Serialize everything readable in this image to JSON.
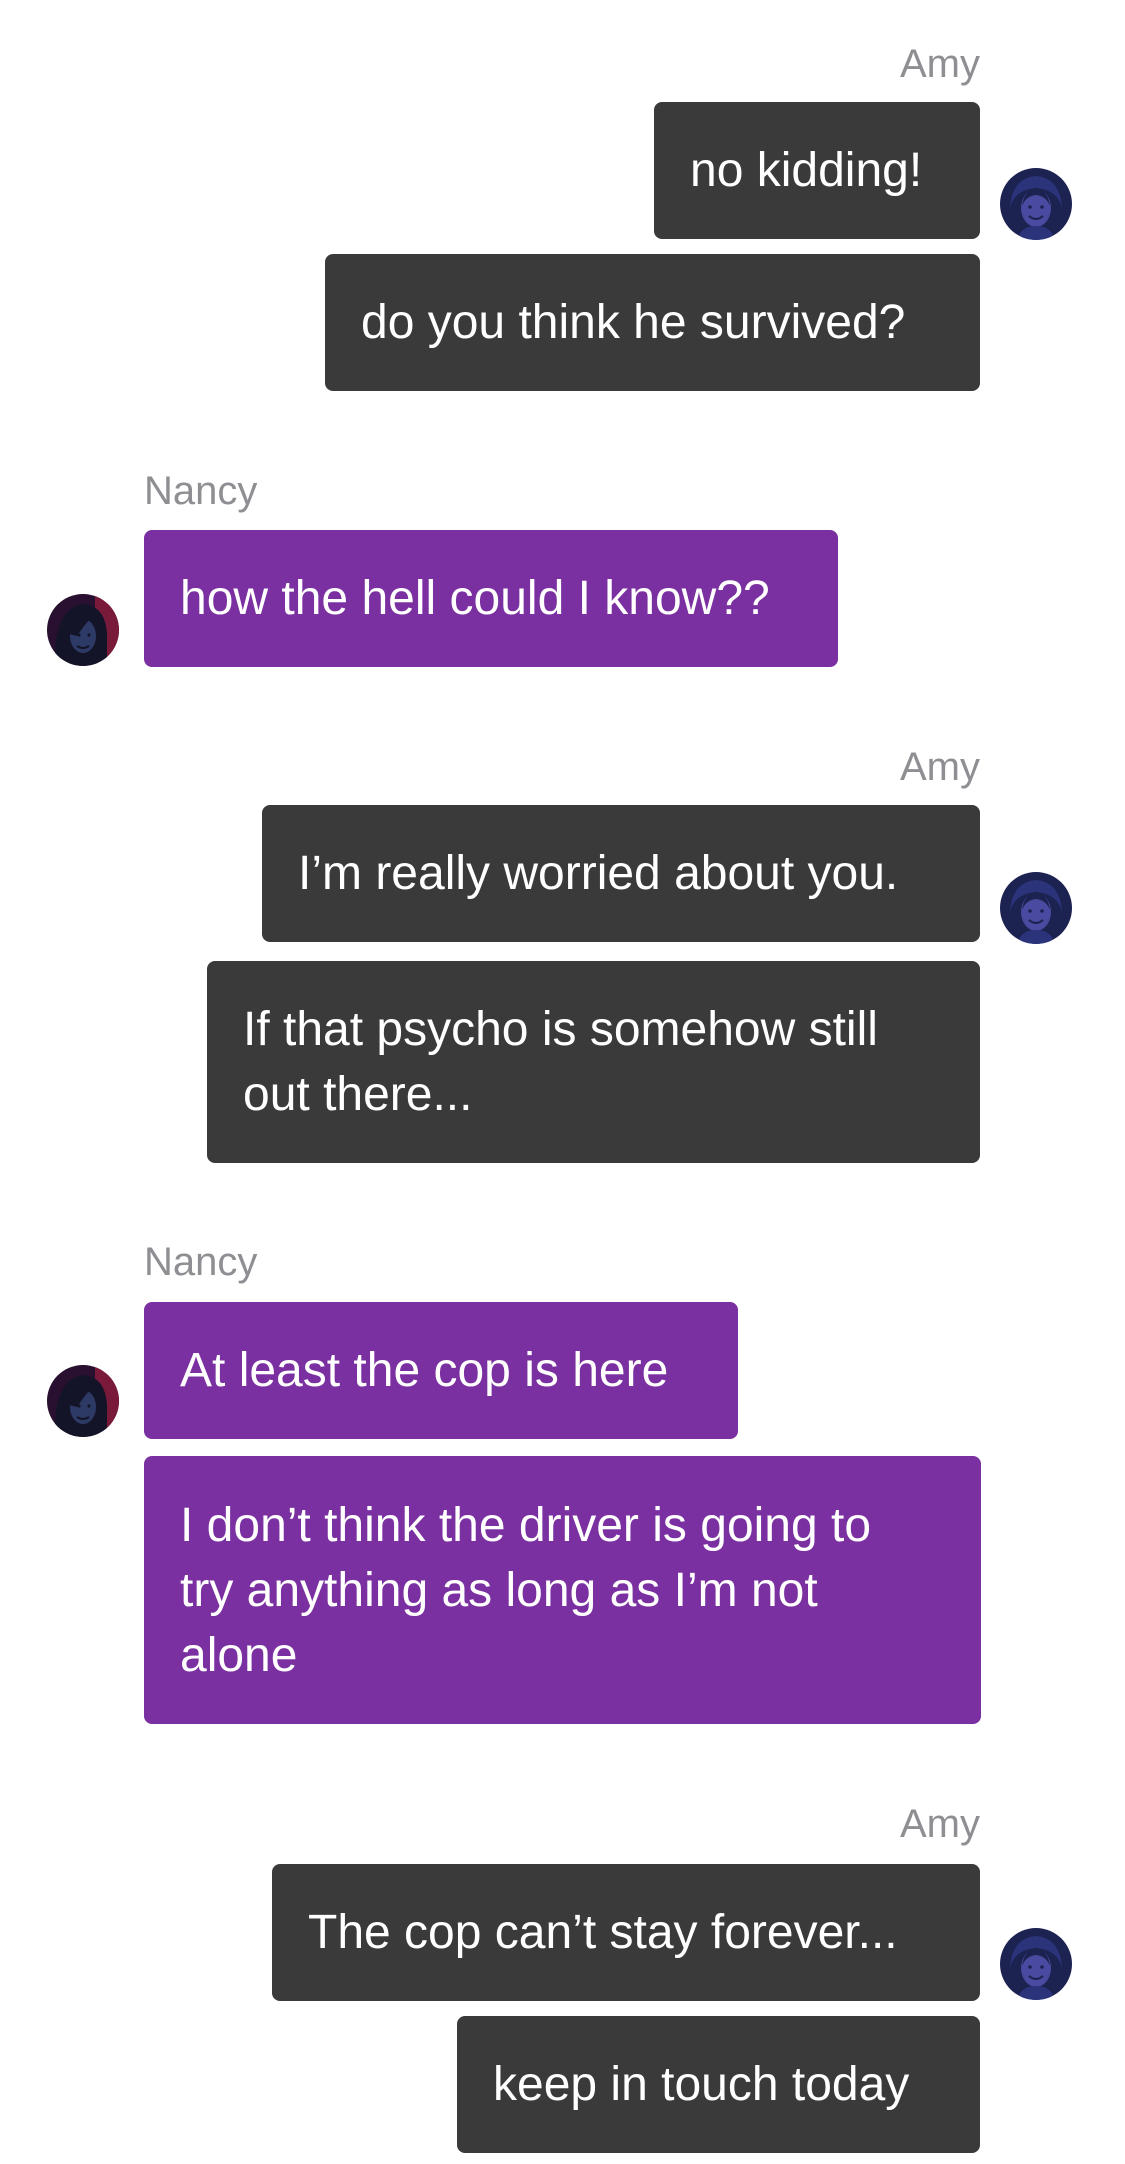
{
  "conversation": {
    "groups": [
      {
        "sender": "Amy",
        "messages": [
          "no kidding!",
          "do you think he survived?"
        ]
      },
      {
        "sender": "Nancy",
        "messages": [
          "how the hell could I know??"
        ]
      },
      {
        "sender": "Amy",
        "messages": [
          "I’m really worried about you.",
          [
            "If that psycho is somehow still",
            "out there..."
          ]
        ]
      },
      {
        "sender": "Nancy",
        "messages": [
          "At least the cop is here",
          [
            "I don’t think the driver is going to",
            "try anything as long as I’m not",
            "alone"
          ]
        ]
      },
      {
        "sender": "Amy",
        "messages": [
          "The cop can’t stay forever...",
          "keep in touch today"
        ]
      }
    ]
  },
  "avatars": {
    "amy": "amy-avatar",
    "nancy": "nancy-avatar"
  },
  "colors": {
    "amy_bubble": "#3a3a3a",
    "nancy_bubble": "#7a30a0",
    "sender_name": "#8e8e93",
    "bubble_text": "#ffffff",
    "background": "#ffffff"
  }
}
